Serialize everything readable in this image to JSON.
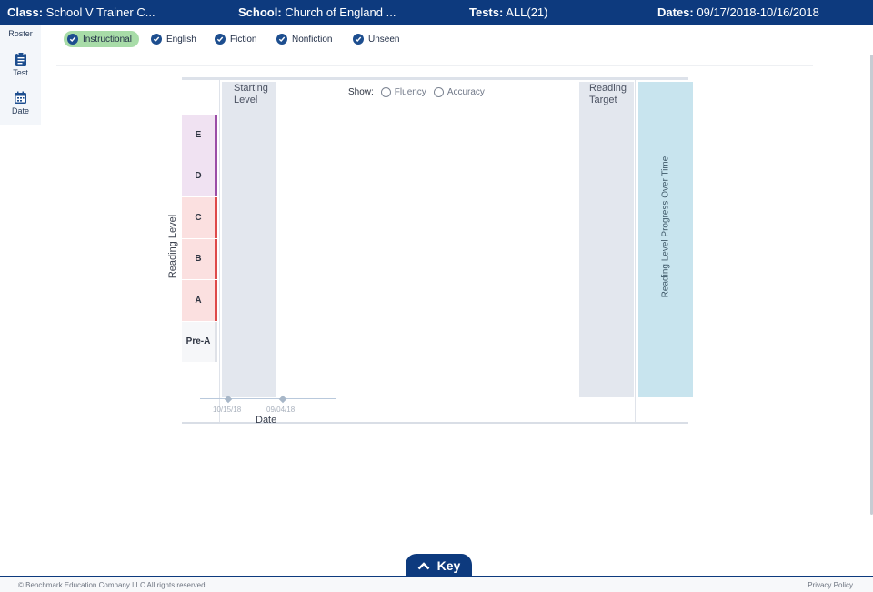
{
  "header": {
    "class_label": "Class:",
    "class_value": "School V Trainer C...",
    "school_label": "School:",
    "school_value": "Church of England ...",
    "tests_label": "Tests:",
    "tests_value": "ALL(21)",
    "dates_label": "Dates:",
    "dates_value": "09/17/2018-10/16/2018"
  },
  "nav": {
    "items": [
      {
        "label": "Roster",
        "icon": "roster-icon"
      },
      {
        "label": "Test",
        "icon": "clipboard-icon"
      },
      {
        "label": "Date",
        "icon": "calendar-icon"
      }
    ]
  },
  "filters": [
    {
      "label": "Instructional",
      "active": true
    },
    {
      "label": "English",
      "active": false
    },
    {
      "label": "Fiction",
      "active": false
    },
    {
      "label": "Nonfiction",
      "active": false
    },
    {
      "label": "Unseen",
      "active": false
    }
  ],
  "chart": {
    "starting_level_label": "Starting Level",
    "reading_target_label": "Reading Target",
    "progress_label": "Reading Level Progress Over Time",
    "show_label": "Show:",
    "show_options": [
      "Fluency",
      "Accuracy"
    ],
    "y_axis_label": "Reading Level",
    "x_axis_label": "Date",
    "levels": [
      {
        "name": "E",
        "color": "#f0e2f2",
        "mark": "#9b4ea7"
      },
      {
        "name": "D",
        "color": "#f0e2f2",
        "mark": "#9b4ea7"
      },
      {
        "name": "C",
        "color": "#fbe0e0",
        "mark": "#de4a4a"
      },
      {
        "name": "B",
        "color": "#fbe0e0",
        "mark": "#de4a4a"
      },
      {
        "name": "A",
        "color": "#fbe0e0",
        "mark": "#de4a4a"
      },
      {
        "name": "Pre-A",
        "color": "#f6f7f9",
        "mark": "#dfe2e8"
      }
    ],
    "dates": [
      "10/15/18",
      "09/04/18"
    ]
  },
  "key": {
    "label": "Key"
  },
  "footer": {
    "copyright": "© Benchmark Education Company LLC All rights reserved.",
    "privacy": "Privacy Policy"
  },
  "colors": {
    "brand": "#0d3a7e",
    "chip_active": "#a8dca8",
    "progress": "#c8e4ee"
  }
}
